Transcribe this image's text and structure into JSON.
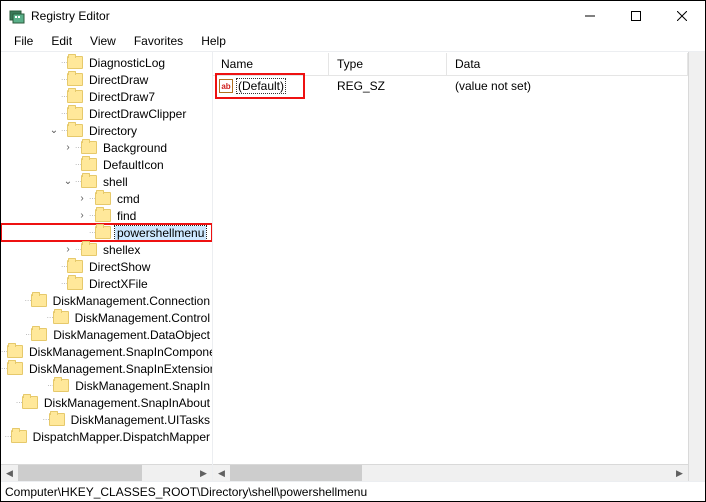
{
  "window": {
    "title": "Registry Editor"
  },
  "menu": {
    "file": "File",
    "edit": "Edit",
    "view": "View",
    "favorites": "Favorites",
    "help": "Help"
  },
  "tree": {
    "items": [
      {
        "depth": 2,
        "toggle": "",
        "label": "DiagnosticLog"
      },
      {
        "depth": 2,
        "toggle": "",
        "label": "DirectDraw"
      },
      {
        "depth": 2,
        "toggle": "",
        "label": "DirectDraw7"
      },
      {
        "depth": 2,
        "toggle": "",
        "label": "DirectDrawClipper"
      },
      {
        "depth": 2,
        "toggle": "v",
        "label": "Directory"
      },
      {
        "depth": 3,
        "toggle": ">",
        "label": "Background"
      },
      {
        "depth": 3,
        "toggle": "",
        "label": "DefaultIcon"
      },
      {
        "depth": 3,
        "toggle": "v",
        "label": "shell"
      },
      {
        "depth": 4,
        "toggle": ">",
        "label": "cmd"
      },
      {
        "depth": 4,
        "toggle": ">",
        "label": "find"
      },
      {
        "depth": 4,
        "toggle": "",
        "label": "powershellmenu",
        "selected": true,
        "highlight": true
      },
      {
        "depth": 3,
        "toggle": ">",
        "label": "shellex"
      },
      {
        "depth": 2,
        "toggle": "",
        "label": "DirectShow"
      },
      {
        "depth": 2,
        "toggle": "",
        "label": "DirectXFile"
      },
      {
        "depth": 2,
        "toggle": "",
        "label": "DiskManagement.Connection"
      },
      {
        "depth": 2,
        "toggle": "",
        "label": "DiskManagement.Control"
      },
      {
        "depth": 2,
        "toggle": "",
        "label": "DiskManagement.DataObject"
      },
      {
        "depth": 2,
        "toggle": "",
        "label": "DiskManagement.SnapInComponent"
      },
      {
        "depth": 2,
        "toggle": "",
        "label": "DiskManagement.SnapInExtension"
      },
      {
        "depth": 2,
        "toggle": "",
        "label": "DiskManagement.SnapIn"
      },
      {
        "depth": 2,
        "toggle": "",
        "label": "DiskManagement.SnapInAbout"
      },
      {
        "depth": 2,
        "toggle": "",
        "label": "DiskManagement.UITasks"
      },
      {
        "depth": 2,
        "toggle": "",
        "label": "DispatchMapper.DispatchMapper"
      }
    ]
  },
  "list": {
    "columns": {
      "name": "Name",
      "type": "Type",
      "data": "Data"
    },
    "rows": [
      {
        "icon": "ab",
        "name": "(Default)",
        "type": "REG_SZ",
        "data": "(value not set)",
        "highlight": true
      }
    ]
  },
  "status": {
    "path": "Computer\\HKEY_CLASSES_ROOT\\Directory\\shell\\powershellmenu"
  }
}
